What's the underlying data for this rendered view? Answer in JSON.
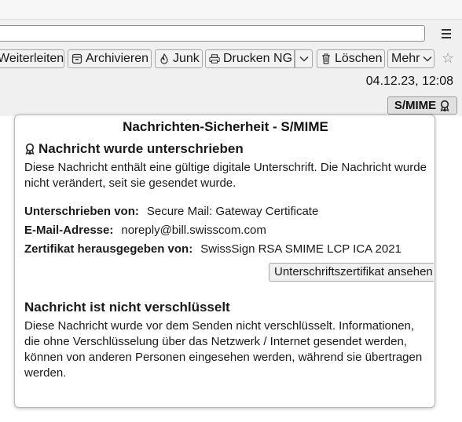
{
  "toolbar": {
    "forward": "Weiterleiten",
    "archive": "Archivieren",
    "junk": "Junk",
    "print": "Drucken NG",
    "delete": "Löschen",
    "more": "Mehr"
  },
  "header": {
    "date": "04.12.23, 12:08",
    "smime_label": "S/MIME"
  },
  "panel": {
    "title": "Nachrichten-Sicherheit - S/MIME",
    "signature": {
      "heading": "Nachricht wurde unterschrieben",
      "text": "Diese Nachricht enthält eine gültige digitale Unterschrift. Die Nachricht wurde nicht verändert, seit sie gesendet wurde.",
      "signed_by_label": "Unterschrieben von:",
      "signed_by_value": "Secure Mail: Gateway Certificate",
      "email_label": "E-Mail-Adresse:",
      "email_value": "noreply@bill.swisscom.com",
      "issuer_label": "Zertifikat herausgegeben von:",
      "issuer_value": "SwissSign RSA SMIME LCP ICA 2021",
      "view_cert_button": "Unterschriftszertifikat ansehen"
    },
    "encryption": {
      "heading": "Nachricht ist nicht verschlüsselt",
      "text": "Diese Nachricht wurde vor dem Senden nicht verschlüsselt. Informationen, die ohne Verschlüsselung über das Netzwerk / Internet gesendet werden, können von anderen Personen eingesehen werden, während sie übertragen werden."
    }
  },
  "icons": {
    "forward": "forward-icon",
    "archive": "archive-icon",
    "junk": "junk-icon",
    "print": "print-icon",
    "delete": "trash-icon",
    "seal": "seal-icon",
    "star": "star-icon",
    "menu": "hamburger-menu-icon"
  }
}
